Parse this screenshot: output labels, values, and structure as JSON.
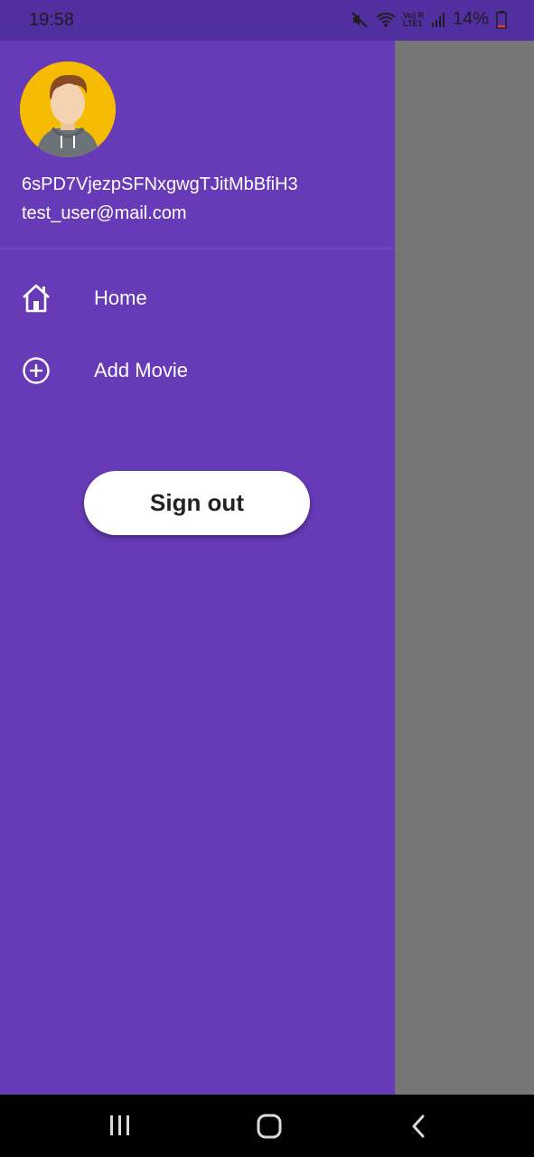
{
  "status_bar": {
    "time": "19:58",
    "network_top": "Vo) R",
    "network_bottom": "LTE1",
    "battery": "14%"
  },
  "drawer": {
    "user_id": "6sPD7VjezpSFNxgwgTJitMbBfiH3",
    "email": "test_user@mail.com",
    "nav_items": [
      {
        "label": "Home",
        "icon": "home-icon"
      },
      {
        "label": "Add Movie",
        "icon": "add-circle-icon"
      }
    ],
    "sign_out_label": "Sign out"
  },
  "colors": {
    "drawer_bg": "#673ab7",
    "status_bar_bg": "#512fa0",
    "scrim": "#767676",
    "avatar_bg": "#f5bb00"
  },
  "system_nav": {
    "buttons": [
      "recents-icon",
      "home-circle-icon",
      "back-icon"
    ]
  }
}
